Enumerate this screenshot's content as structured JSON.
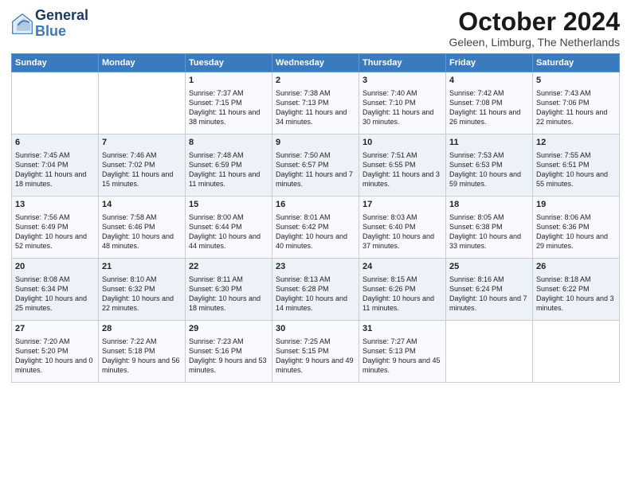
{
  "header": {
    "logo_line1": "General",
    "logo_line2": "Blue",
    "month_title": "October 2024",
    "location": "Geleen, Limburg, The Netherlands"
  },
  "days_of_week": [
    "Sunday",
    "Monday",
    "Tuesday",
    "Wednesday",
    "Thursday",
    "Friday",
    "Saturday"
  ],
  "weeks": [
    [
      {
        "day": "",
        "info": ""
      },
      {
        "day": "",
        "info": ""
      },
      {
        "day": "1",
        "info": "Sunrise: 7:37 AM\nSunset: 7:15 PM\nDaylight: 11 hours and 38 minutes."
      },
      {
        "day": "2",
        "info": "Sunrise: 7:38 AM\nSunset: 7:13 PM\nDaylight: 11 hours and 34 minutes."
      },
      {
        "day": "3",
        "info": "Sunrise: 7:40 AM\nSunset: 7:10 PM\nDaylight: 11 hours and 30 minutes."
      },
      {
        "day": "4",
        "info": "Sunrise: 7:42 AM\nSunset: 7:08 PM\nDaylight: 11 hours and 26 minutes."
      },
      {
        "day": "5",
        "info": "Sunrise: 7:43 AM\nSunset: 7:06 PM\nDaylight: 11 hours and 22 minutes."
      }
    ],
    [
      {
        "day": "6",
        "info": "Sunrise: 7:45 AM\nSunset: 7:04 PM\nDaylight: 11 hours and 18 minutes."
      },
      {
        "day": "7",
        "info": "Sunrise: 7:46 AM\nSunset: 7:02 PM\nDaylight: 11 hours and 15 minutes."
      },
      {
        "day": "8",
        "info": "Sunrise: 7:48 AM\nSunset: 6:59 PM\nDaylight: 11 hours and 11 minutes."
      },
      {
        "day": "9",
        "info": "Sunrise: 7:50 AM\nSunset: 6:57 PM\nDaylight: 11 hours and 7 minutes."
      },
      {
        "day": "10",
        "info": "Sunrise: 7:51 AM\nSunset: 6:55 PM\nDaylight: 11 hours and 3 minutes."
      },
      {
        "day": "11",
        "info": "Sunrise: 7:53 AM\nSunset: 6:53 PM\nDaylight: 10 hours and 59 minutes."
      },
      {
        "day": "12",
        "info": "Sunrise: 7:55 AM\nSunset: 6:51 PM\nDaylight: 10 hours and 55 minutes."
      }
    ],
    [
      {
        "day": "13",
        "info": "Sunrise: 7:56 AM\nSunset: 6:49 PM\nDaylight: 10 hours and 52 minutes."
      },
      {
        "day": "14",
        "info": "Sunrise: 7:58 AM\nSunset: 6:46 PM\nDaylight: 10 hours and 48 minutes."
      },
      {
        "day": "15",
        "info": "Sunrise: 8:00 AM\nSunset: 6:44 PM\nDaylight: 10 hours and 44 minutes."
      },
      {
        "day": "16",
        "info": "Sunrise: 8:01 AM\nSunset: 6:42 PM\nDaylight: 10 hours and 40 minutes."
      },
      {
        "day": "17",
        "info": "Sunrise: 8:03 AM\nSunset: 6:40 PM\nDaylight: 10 hours and 37 minutes."
      },
      {
        "day": "18",
        "info": "Sunrise: 8:05 AM\nSunset: 6:38 PM\nDaylight: 10 hours and 33 minutes."
      },
      {
        "day": "19",
        "info": "Sunrise: 8:06 AM\nSunset: 6:36 PM\nDaylight: 10 hours and 29 minutes."
      }
    ],
    [
      {
        "day": "20",
        "info": "Sunrise: 8:08 AM\nSunset: 6:34 PM\nDaylight: 10 hours and 25 minutes."
      },
      {
        "day": "21",
        "info": "Sunrise: 8:10 AM\nSunset: 6:32 PM\nDaylight: 10 hours and 22 minutes."
      },
      {
        "day": "22",
        "info": "Sunrise: 8:11 AM\nSunset: 6:30 PM\nDaylight: 10 hours and 18 minutes."
      },
      {
        "day": "23",
        "info": "Sunrise: 8:13 AM\nSunset: 6:28 PM\nDaylight: 10 hours and 14 minutes."
      },
      {
        "day": "24",
        "info": "Sunrise: 8:15 AM\nSunset: 6:26 PM\nDaylight: 10 hours and 11 minutes."
      },
      {
        "day": "25",
        "info": "Sunrise: 8:16 AM\nSunset: 6:24 PM\nDaylight: 10 hours and 7 minutes."
      },
      {
        "day": "26",
        "info": "Sunrise: 8:18 AM\nSunset: 6:22 PM\nDaylight: 10 hours and 3 minutes."
      }
    ],
    [
      {
        "day": "27",
        "info": "Sunrise: 7:20 AM\nSunset: 5:20 PM\nDaylight: 10 hours and 0 minutes."
      },
      {
        "day": "28",
        "info": "Sunrise: 7:22 AM\nSunset: 5:18 PM\nDaylight: 9 hours and 56 minutes."
      },
      {
        "day": "29",
        "info": "Sunrise: 7:23 AM\nSunset: 5:16 PM\nDaylight: 9 hours and 53 minutes."
      },
      {
        "day": "30",
        "info": "Sunrise: 7:25 AM\nSunset: 5:15 PM\nDaylight: 9 hours and 49 minutes."
      },
      {
        "day": "31",
        "info": "Sunrise: 7:27 AM\nSunset: 5:13 PM\nDaylight: 9 hours and 45 minutes."
      },
      {
        "day": "",
        "info": ""
      },
      {
        "day": "",
        "info": ""
      }
    ]
  ]
}
